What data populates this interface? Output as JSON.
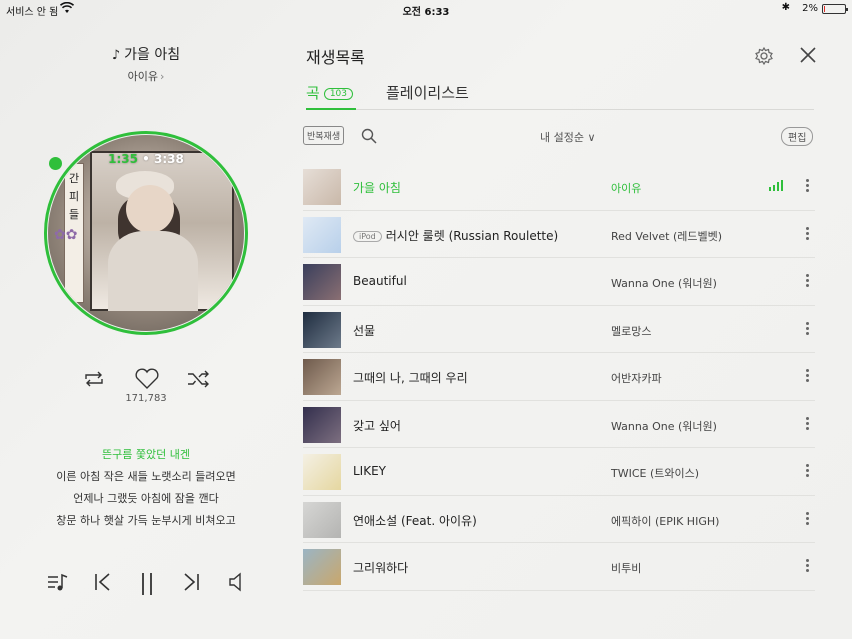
{
  "status_bar": {
    "carrier": "서비스 안 됨",
    "time": "오전 6:33",
    "battery": "2%",
    "icons": [
      "wifi-icon",
      "bluetooth-icon",
      "battery-icon"
    ]
  },
  "now_playing": {
    "title": "가을 아침",
    "artist": "아이유",
    "current_time": "1:35",
    "total_time": "3:38",
    "album_sign_text": "간 피 들",
    "likes": "171,783",
    "lyrics": [
      "뜬구름 쫓았던 내겐",
      "이른 아침 작은 새들 노랫소리 들려오면",
      "언제나 그랬듯 아침에 잠을 깬다",
      "창문 하나 햇살 가득 눈부시게 비쳐오고"
    ],
    "accent_color": "#2fbf3b"
  },
  "playlist": {
    "title": "재생목록",
    "tabs": [
      {
        "label": "곡",
        "badge": "103"
      },
      {
        "label": "플레이리스트"
      }
    ],
    "repeat_label": "반복재생",
    "sort_label": "내 설정순",
    "edit_label": "편집",
    "ipod_label": "iPod",
    "songs": [
      {
        "title": "가을 아침",
        "artist": "아이유",
        "playing": true
      },
      {
        "title": "러시안 룰렛 (Russian Roulette)",
        "artist": "Red Velvet (레드벨벳)",
        "ipod": true
      },
      {
        "title": "Beautiful",
        "artist": "Wanna One (워너원)"
      },
      {
        "title": "선물",
        "artist": "멜로망스"
      },
      {
        "title": "그때의 나, 그때의 우리",
        "artist": "어반자카파"
      },
      {
        "title": "갖고 싶어",
        "artist": "Wanna One (워너원)"
      },
      {
        "title": "LIKEY",
        "artist": "TWICE (트와이스)"
      },
      {
        "title": "연애소설 (Feat. 아이유)",
        "artist": "에픽하이 (EPIK HIGH)"
      },
      {
        "title": "그리워하다",
        "artist": "비투비"
      }
    ]
  }
}
